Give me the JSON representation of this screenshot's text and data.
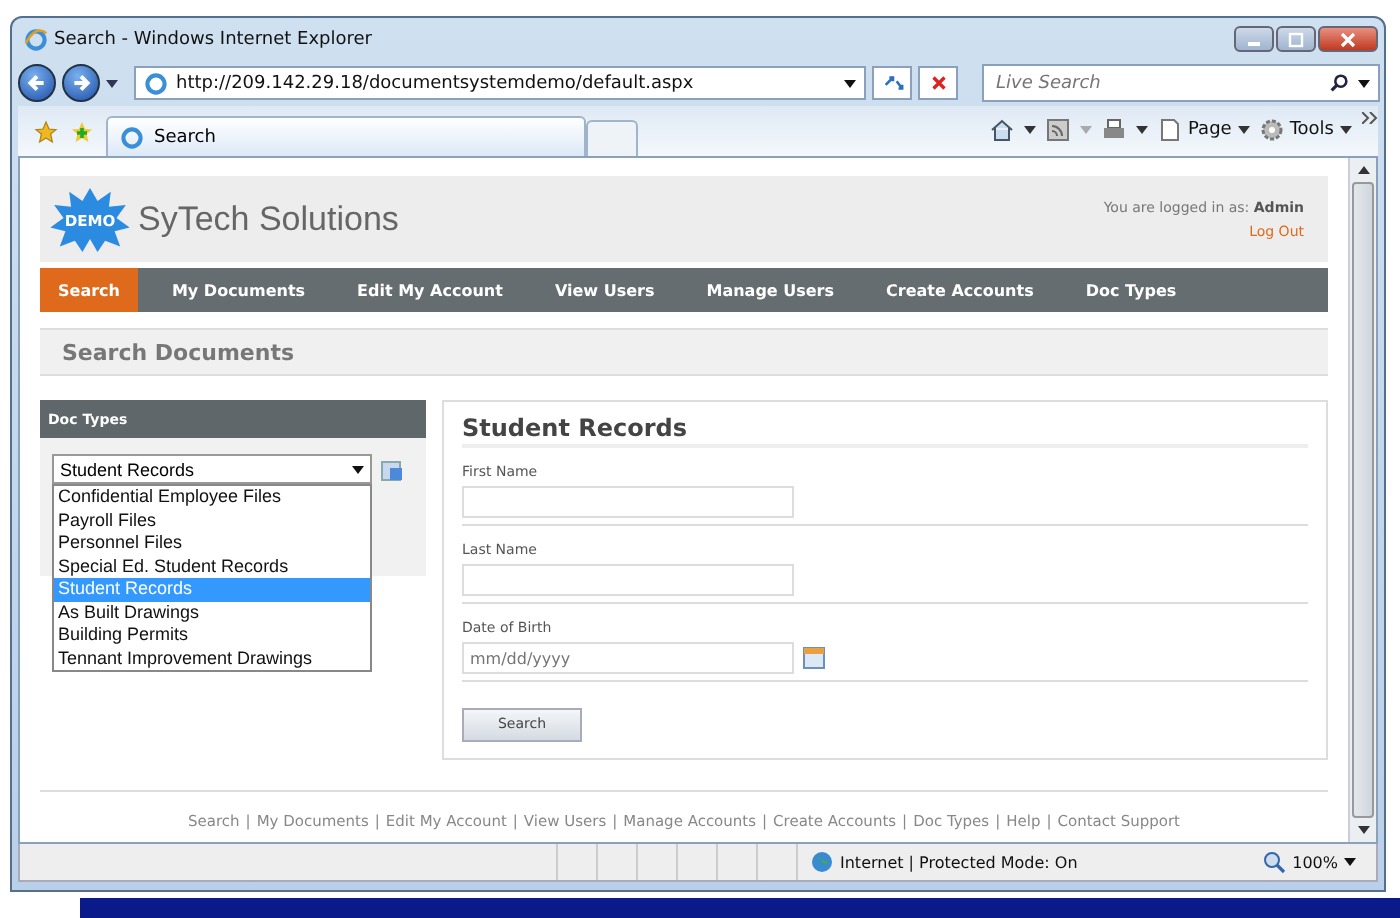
{
  "window": {
    "title": "Search - Windows Internet Explorer"
  },
  "address_bar": {
    "url": "http://209.142.29.18/documentsystemdemo/default.aspx"
  },
  "search_box": {
    "placeholder": "Live Search"
  },
  "tabs": [
    {
      "label": "Search",
      "selected": true
    }
  ],
  "toolbar": {
    "page": "Page",
    "tools": "Tools"
  },
  "site": {
    "logo_badge": "DEMO",
    "name": "SyTech Solutions",
    "login_label": "You are logged in as:",
    "user": "Admin",
    "logout": "Log Out"
  },
  "nav": [
    {
      "label": "Search",
      "selected": true
    },
    {
      "label": "My Documents",
      "selected": false
    },
    {
      "label": "Edit My Account",
      "selected": false
    },
    {
      "label": "View Users",
      "selected": false
    },
    {
      "label": "Manage Users",
      "selected": false
    },
    {
      "label": "Create Accounts",
      "selected": false
    },
    {
      "label": "Doc Types",
      "selected": false
    }
  ],
  "page_title": "Search Documents",
  "sidebar": {
    "title": "Doc Types",
    "select_value": "Student Records",
    "options": [
      {
        "label": "Confidential Employee Files",
        "selected": false
      },
      {
        "label": "Payroll Files",
        "selected": false
      },
      {
        "label": "Personnel Files",
        "selected": false
      },
      {
        "label": "Special Ed. Student Records",
        "selected": false
      },
      {
        "label": "Student Records",
        "selected": true
      },
      {
        "label": "As Built Drawings",
        "selected": false
      },
      {
        "label": "Building Permits",
        "selected": false
      },
      {
        "label": "Tennant Improvement Drawings",
        "selected": false
      }
    ]
  },
  "form": {
    "title": "Student Records",
    "fields": [
      {
        "label": "First Name",
        "kind": "text"
      },
      {
        "label": "Last Name",
        "kind": "text"
      },
      {
        "label": "Date of Birth",
        "kind": "date",
        "placeholder": "mm/dd/yyyy"
      }
    ],
    "button": "Search"
  },
  "footer": {
    "separator": "|",
    "links": [
      "Search",
      "My Documents",
      "Edit My Account",
      "View Users",
      "Manage Accounts",
      "Create Accounts",
      "Doc Types",
      "Help",
      "Contact Support"
    ]
  },
  "status_bar": {
    "zone": "Internet | Protected Mode: On",
    "zoom": "100%"
  }
}
